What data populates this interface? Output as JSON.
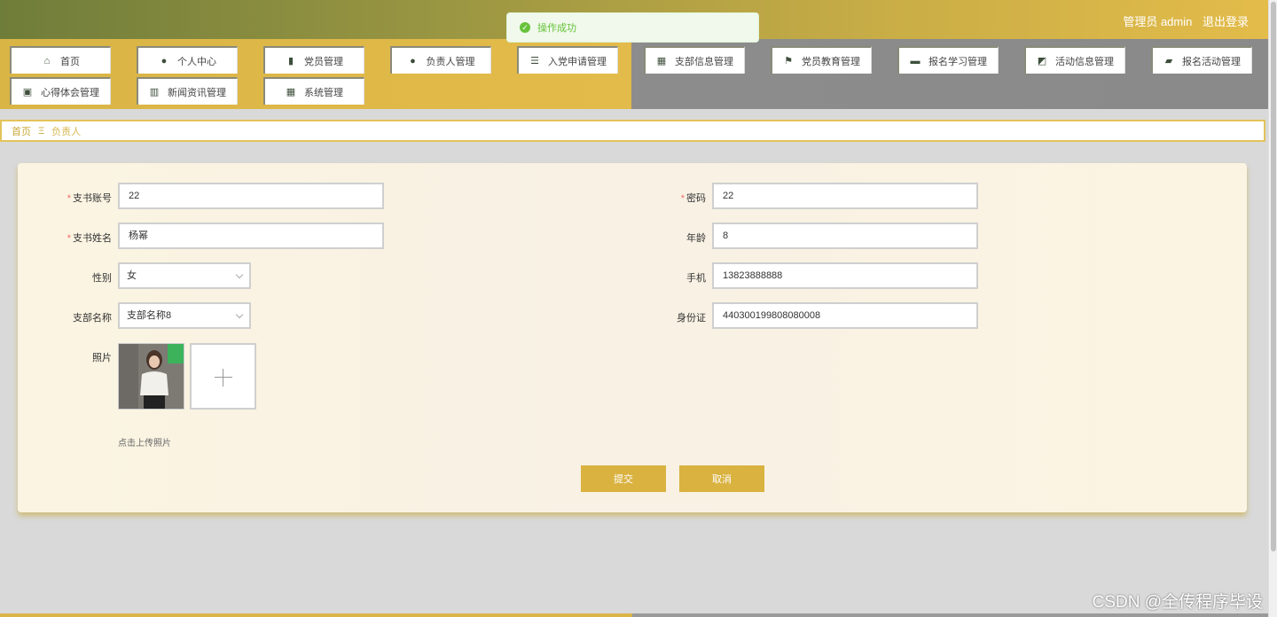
{
  "header": {
    "role_user": "管理员 admin",
    "logout": "退出登录"
  },
  "toast": {
    "message": "操作成功"
  },
  "nav": {
    "row1": [
      "首页",
      "个人中心",
      "党员管理",
      "负责人管理",
      "入党申请管理",
      "支部信息管理",
      "党员教育管理",
      "报名学习管理",
      "活动信息管理",
      "报名活动管理"
    ],
    "row2": [
      "心得体会管理",
      "新闻资讯管理",
      "系统管理"
    ]
  },
  "breadcrumb": {
    "home": "首页",
    "sep": "Ξ",
    "current": "负责人"
  },
  "form": {
    "account_label": "支书账号",
    "account_value": "22",
    "password_label": "密码",
    "password_value": "22",
    "name_label": "支书姓名",
    "name_value": "杨幂",
    "age_label": "年龄",
    "age_value": "8",
    "gender_label": "性别",
    "gender_value": "女",
    "phone_label": "手机",
    "phone_value": "13823888888",
    "branch_label": "支部名称",
    "branch_value": "支部名称8",
    "idcard_label": "身份证",
    "idcard_value": "440300199808080008",
    "photo_label": "照片",
    "upload_tip": "点击上传照片",
    "submit": "提交",
    "cancel": "取消",
    "required_mark": "*"
  },
  "watermark": "CSDN @全传程序毕设"
}
